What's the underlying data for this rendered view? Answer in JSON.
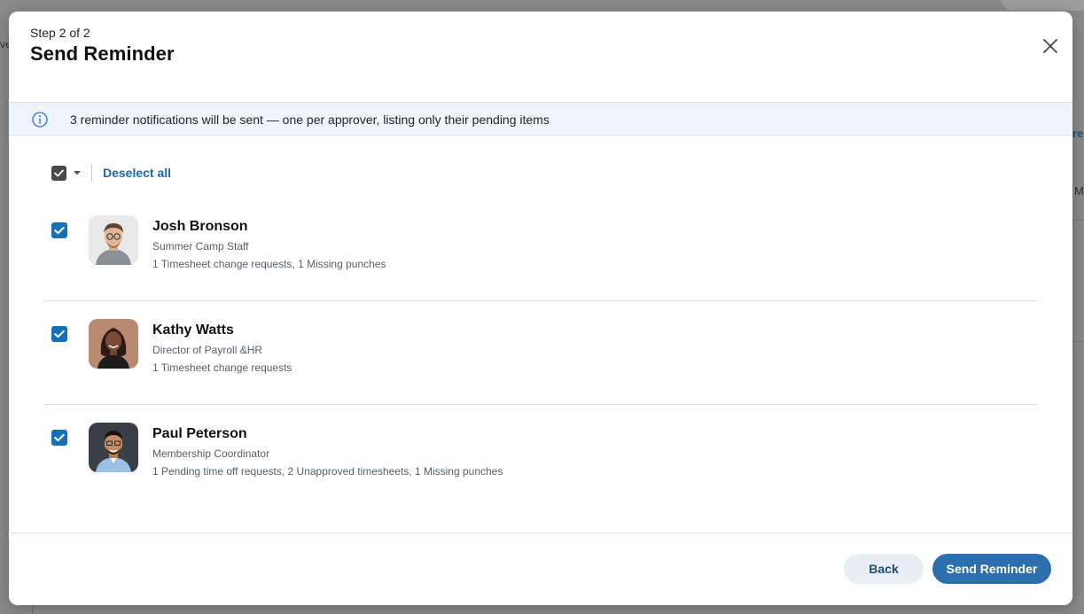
{
  "background": {
    "fragment_left": "ve",
    "fragment_right_1": "re",
    "fragment_right_2": "M"
  },
  "modal": {
    "step_label": "Step 2 of 2",
    "title": "Send Reminder",
    "close_icon": "close-icon"
  },
  "info_banner": {
    "icon": "info-icon",
    "text": "3 reminder notifications will be sent — one per approver, listing only their pending items"
  },
  "bulk_select": {
    "checkbox_icon": "checkbox-checked-icon",
    "caret_icon": "chevron-down-icon",
    "deselect_label": "Deselect all"
  },
  "approvers": [
    {
      "name": "Josh Bronson",
      "role": "Summer Camp Staff",
      "pending": "1 Timesheet change requests, 1 Missing punches",
      "checked": true
    },
    {
      "name": "Kathy Watts",
      "role": "Director of Payroll &HR",
      "pending": "1 Timesheet change requests",
      "checked": true
    },
    {
      "name": "Paul Peterson",
      "role": "Membership Coordinator",
      "pending": "1 Pending time off requests, 2 Unapproved timesheets, 1 Missing punches",
      "checked": true
    }
  ],
  "footer": {
    "back_label": "Back",
    "send_label": "Send Reminder"
  },
  "colors": {
    "primary": "#2c6fae",
    "checkbox": "#1570b8",
    "link": "#1d6aa5",
    "banner_bg": "#eef3fc",
    "info_icon": "#4a7bdc"
  }
}
